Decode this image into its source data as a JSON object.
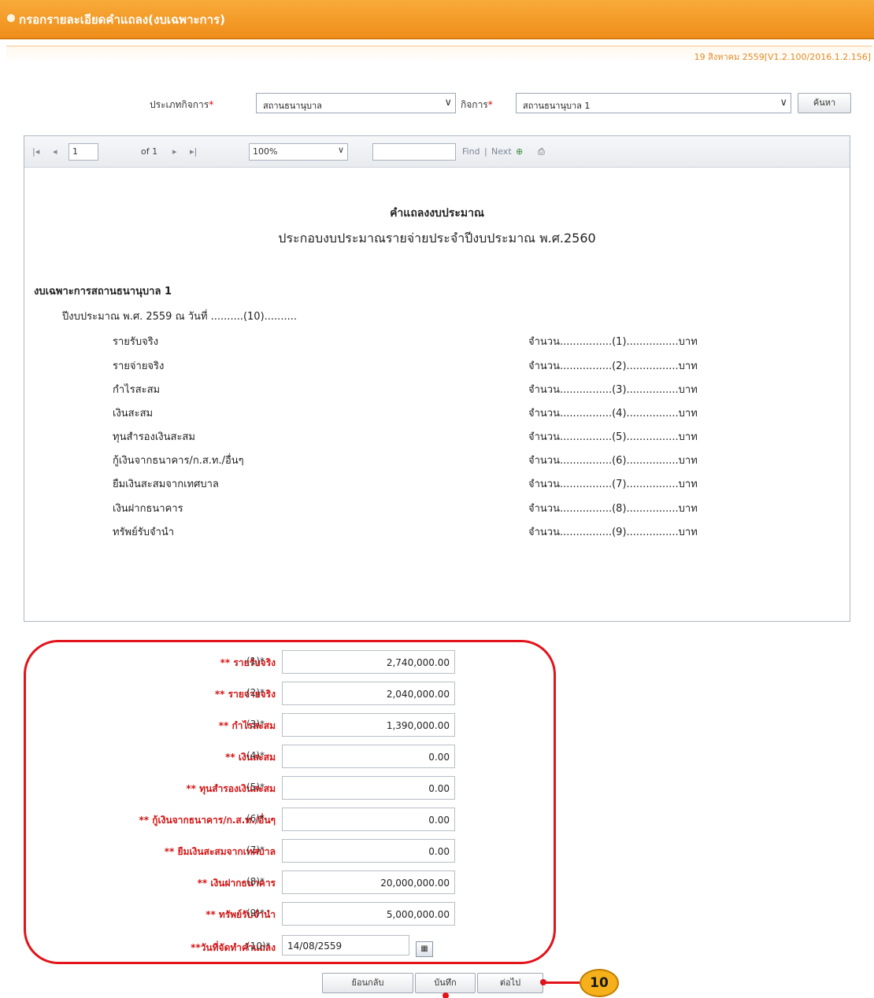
{
  "window": {
    "title": "กรอกรายละเอียดคำแถลง(งบเฉพาะการ)",
    "version_text": "19 สิงหาคม 2559[V1.2.100/2016.1.2.156]"
  },
  "filters": {
    "type_label": "ประเภทกิจการ",
    "type_value": "สถานธนานุบาล",
    "business_label": "กิจการ",
    "business_value": "สถานธนานุบาล 1",
    "search_label": "ค้นหา",
    "required_mark": "*"
  },
  "viewer_toolbar": {
    "first_icon": "first-page-icon",
    "prev_icon": "prev-page-icon",
    "page_value": "1",
    "page_of": "of 1",
    "next_icon": "next-page-icon",
    "last_icon": "last-page-icon",
    "zoom_value": "100%",
    "find_value": "",
    "find_label": "Find",
    "separator": "|",
    "next_label": "Next",
    "export_icon": "export-icon",
    "print_icon": "print-icon"
  },
  "report": {
    "title": "คำแถลงงบประมาณ",
    "subtitle": "ประกอบงบประมาณรายจ่ายประจำปีงบประมาณ พ.ศ.2560",
    "section": "งบเฉพาะการสถานธนานุบาล 1",
    "dateline": "ปีงบประมาณ พ.ศ. 2559 ณ วันที่ ..........(10)..........",
    "rows": [
      {
        "label": "รายรับจริง",
        "amount": "จำนวน................(1)................บาท"
      },
      {
        "label": "รายจ่ายจริง",
        "amount": "จำนวน................(2)................บาท"
      },
      {
        "label": "กำไรสะสม",
        "amount": "จำนวน................(3)................บาท"
      },
      {
        "label": "เงินสะสม",
        "amount": "จำนวน................(4)................บาท"
      },
      {
        "label": "ทุนสำรองเงินสะสม",
        "amount": "จำนวน................(5)................บาท"
      },
      {
        "label": "กู้เงินจากธนาคาร/ก.ส.ท./อื่นๆ",
        "amount": "จำนวน................(6)................บาท"
      },
      {
        "label": "ยืมเงินสะสมจากเทศบาล",
        "amount": "จำนวน................(7)................บาท"
      },
      {
        "label": "เงินฝากธนาคาร",
        "amount": "จำนวน................(8)................บาท"
      },
      {
        "label": "ทรัพย์รับจำนำ",
        "amount": "จำนวน................(9)................บาท"
      }
    ]
  },
  "form": {
    "fields": [
      {
        "label": "** รายรับจริง",
        "num": "(1)*",
        "value": "2,740,000.00"
      },
      {
        "label": "** รายจ่ายจริง",
        "num": "(2)*",
        "value": "2,040,000.00"
      },
      {
        "label": "** กำไรสะสม",
        "num": "(3)*",
        "value": "1,390,000.00"
      },
      {
        "label": "** เงินสะสม",
        "num": "(4)*",
        "value": "0.00"
      },
      {
        "label": "** ทุนสำรองเงินสะสม",
        "num": "(5)*",
        "value": "0.00"
      },
      {
        "label": "** กู้เงินจากธนาคาร/ก.ส.ท./อื่นๆ",
        "num": "(6)*",
        "value": "0.00"
      },
      {
        "label": "** ยืมเงินสะสมจากเทศบาล",
        "num": "(7)*",
        "value": "0.00"
      },
      {
        "label": "** เงินฝากธนาคาร",
        "num": "(8)*",
        "value": "20,000,000.00"
      },
      {
        "label": "** ทรัพย์รับจำนำ",
        "num": "(9)*",
        "value": "5,000,000.00"
      }
    ],
    "date_label": "**วันที่จัดทำคำแถลง",
    "date_num": "(10)*",
    "date_value": "14/08/2559",
    "calendar_icon": "calendar-icon"
  },
  "actions": {
    "back": "ย้อนกลับ",
    "save": "บันทึก",
    "next": "ต่อไป"
  },
  "annotation": {
    "step": "10"
  },
  "colors": {
    "title_bar": "#f39a25",
    "required": "#d41414",
    "highlight": "#e2131a",
    "callout": "#f5b01c"
  }
}
